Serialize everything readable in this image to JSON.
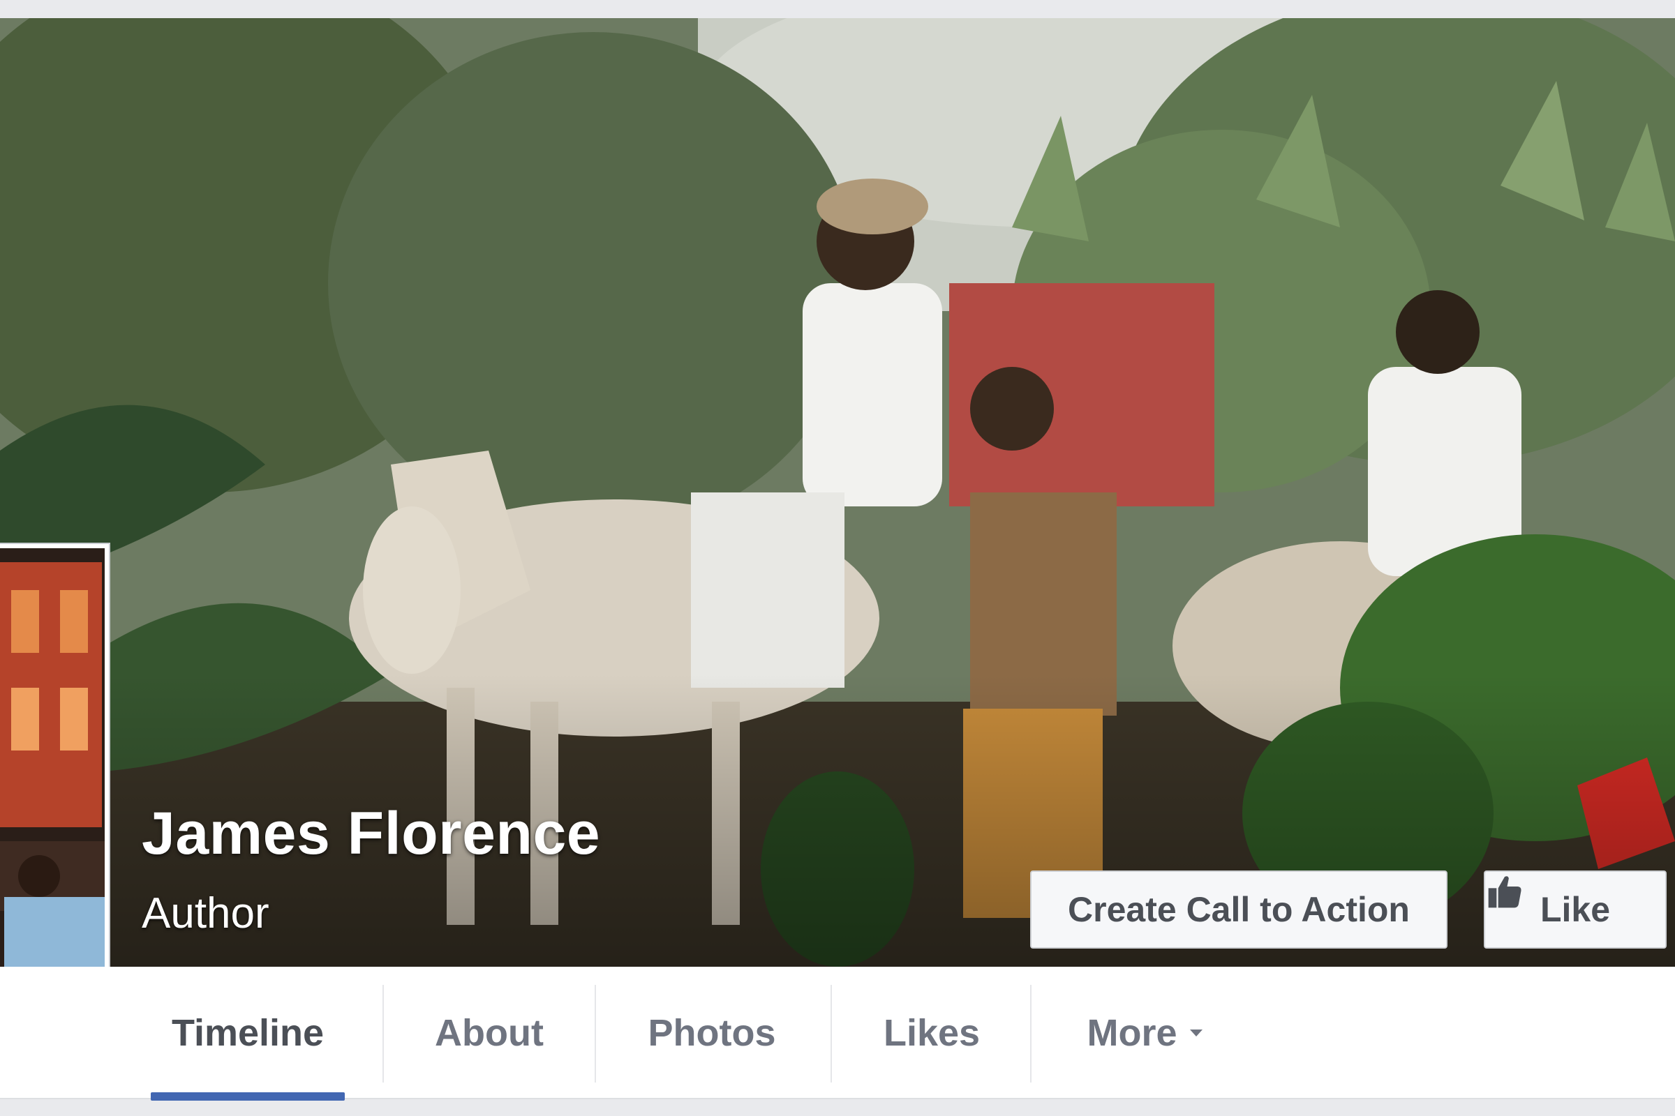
{
  "page": {
    "name": "James Florence",
    "category": "Author"
  },
  "cover": {
    "buttons": {
      "cta_label": "Create Call to Action",
      "like_label": "Like"
    }
  },
  "nav": {
    "tabs": [
      {
        "label": "Timeline",
        "active": true
      },
      {
        "label": "About",
        "active": false
      },
      {
        "label": "Photos",
        "active": false
      },
      {
        "label": "Likes",
        "active": false
      },
      {
        "label": "More",
        "active": false
      }
    ]
  },
  "colors": {
    "accent": "#4267b2",
    "tab_text": "#6f7480",
    "active_tab_text": "#4b4f56"
  }
}
